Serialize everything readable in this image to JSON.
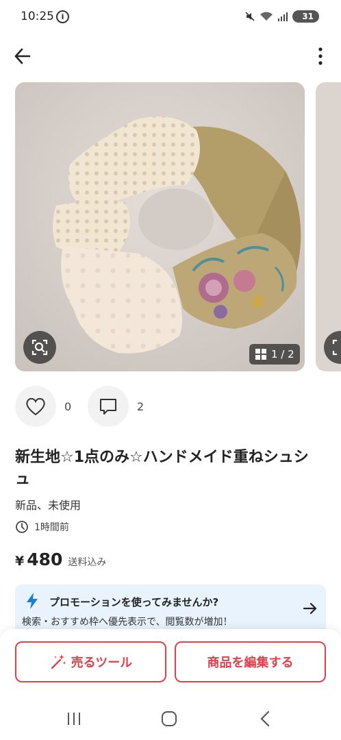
{
  "status": {
    "time": "10:25",
    "info_glyph": "i",
    "battery": "31"
  },
  "header": {
    "back_icon": "arrow-left-icon",
    "more_icon": "more-vertical-icon"
  },
  "gallery": {
    "counter": "1 / 2",
    "current_index": 1,
    "total": 2
  },
  "actions": {
    "likes": "0",
    "comments": "2"
  },
  "item": {
    "title": "新生地☆1点のみ☆ハンドメイド重ねシュシュ",
    "condition": "新品、未使用",
    "posted": "1時間前",
    "price_symbol": "¥",
    "price": "480",
    "shipping": "送料込み"
  },
  "promo": {
    "title": "プロモーションを使ってみませんか?",
    "subtitle": "検索・おすすめ枠へ優先表示で、閲覧数が増加！"
  },
  "buttons": {
    "sell_tools": "売るツール",
    "edit_item": "商品を編集する"
  },
  "colors": {
    "accent": "#e0404a",
    "promo_bg": "#e8f3fd",
    "bolt": "#1a7fd4"
  }
}
